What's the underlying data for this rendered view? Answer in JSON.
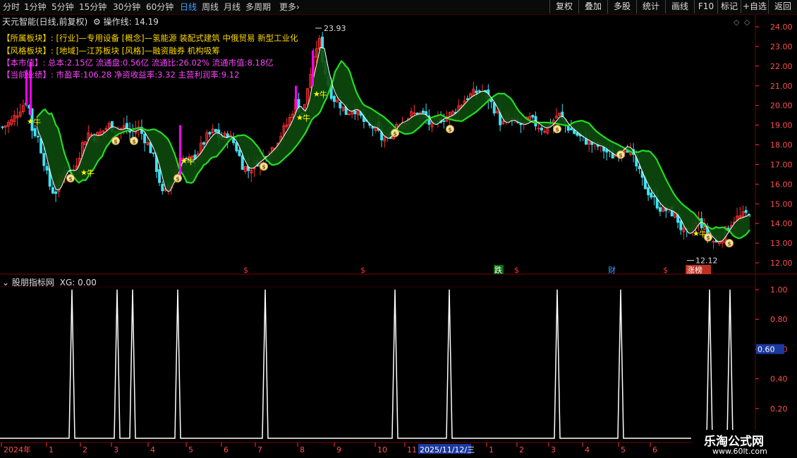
{
  "toolbar": {
    "timeframes": [
      "分时",
      "1分钟",
      "5分钟",
      "15分钟",
      "30分钟",
      "60分钟",
      "日线",
      "周线",
      "月线",
      "多周期",
      "更多"
    ],
    "active": "日线",
    "more_arrow": "›",
    "right_buttons": [
      "复权",
      "叠加",
      "多股",
      "统计",
      "画线",
      "F10",
      "标记",
      "+自选",
      "返回"
    ]
  },
  "header": {
    "stock_title": "天元智能(日线,前复权)",
    "line_label": "操作线:",
    "line_value": "14.19"
  },
  "info_lines": {
    "sector_label": "【所属板块】:",
    "sector_value": "[行业]—专用设备 [概念]—氢能源 装配式建筑 中俄贸易 新型工业化",
    "style_label": "【风格板块】:",
    "style_value": "[地域]—江苏板块 [风格]—融资融券 机构吸筹",
    "mcap_label": "【本市值】:",
    "mcap_value": "总本:2.15亿 流通盘:0.56亿 流通比:26.02% 流通市值:8.18亿",
    "perf_label": "【当前业绩】:",
    "perf_value": "市盈率:106.28 净资收益率:3.32 主营利润率:9.12"
  },
  "main_chart": {
    "y_ticks": [
      "24.00",
      "23.00",
      "22.00",
      "21.00",
      "20.00",
      "19.00",
      "18.00",
      "17.00",
      "16.00",
      "15.00",
      "14.00",
      "13.00",
      "12.00"
    ],
    "high_label": "23.93",
    "low_label": "12.12",
    "marker_labels": {
      "die": "跌",
      "cai": "财",
      "zhang": "涨榜"
    },
    "signal_glyph": "牛",
    "money_glyph": "$",
    "colors": {
      "up": "#ff3030",
      "down": "#40e0f0",
      "ma_fast": "#ffffff",
      "ma_slow": "#22dd22",
      "fill": "#0d4a0d",
      "marker": "#ff00ff",
      "star": "#ffff00"
    }
  },
  "sub_chart": {
    "title": "股朋指标网",
    "xg_label": "XG:",
    "xg_value": "0.00",
    "y_ticks": [
      "1.00",
      "0.80",
      "0.60",
      "0.40",
      "0.20"
    ],
    "current_badge": "0.60"
  },
  "x_axis": {
    "labels": [
      "2024年",
      "1",
      "2",
      "3",
      "4",
      "5",
      "6",
      "7",
      "8",
      "9",
      "10",
      "11",
      "2025/11/12/三",
      "1",
      "2",
      "3",
      "4",
      "5",
      "6"
    ]
  },
  "watermark": {
    "name": "乐淘公式网",
    "url": "www.60lt.com"
  }
}
